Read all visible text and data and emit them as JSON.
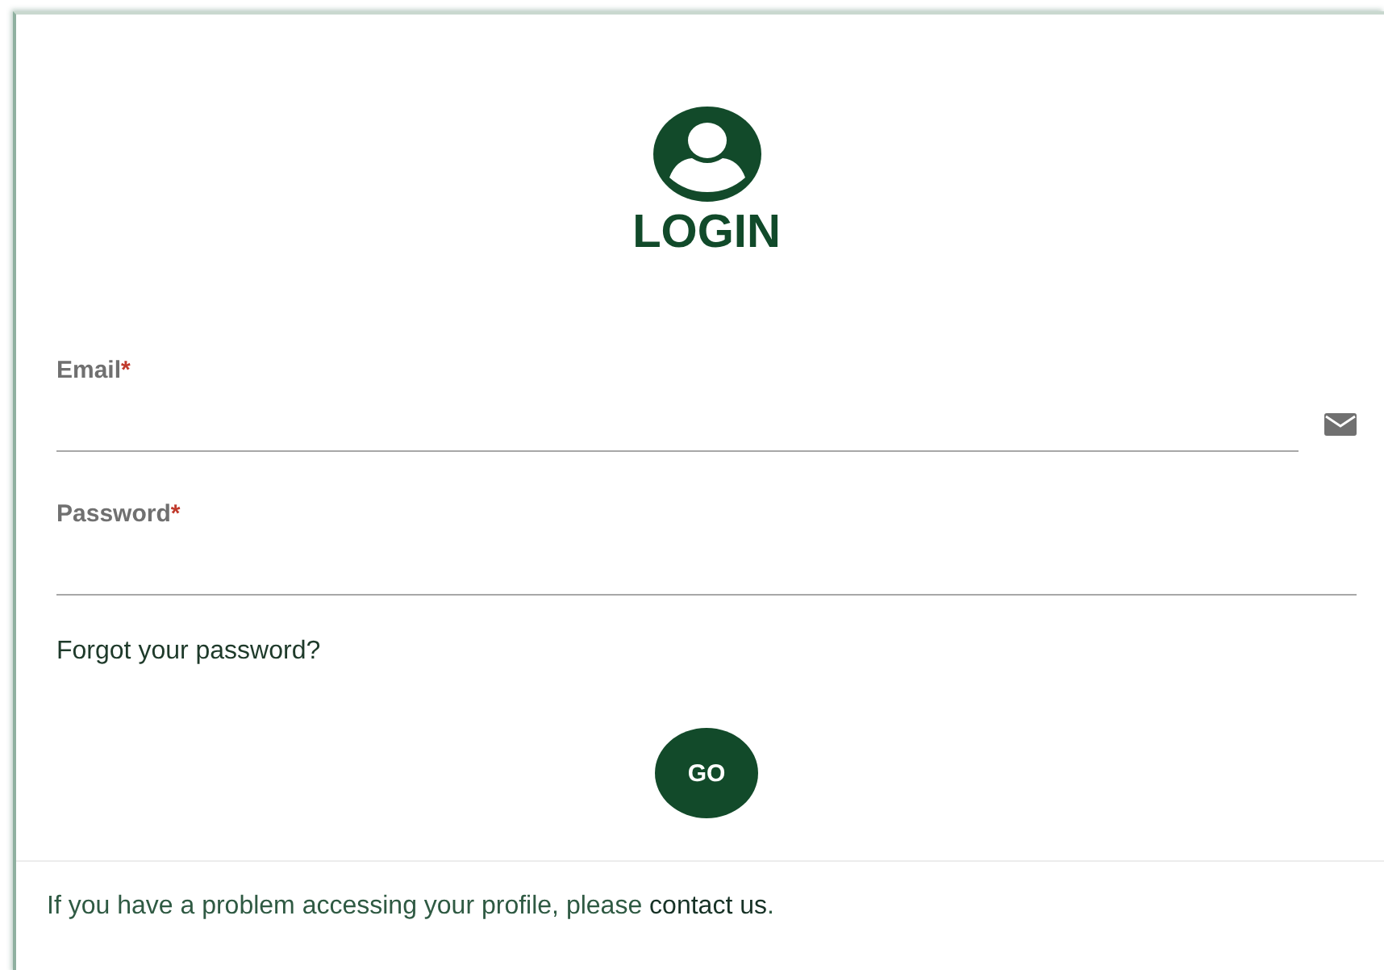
{
  "title": "LOGIN",
  "fields": [
    {
      "label": "Email",
      "required_mark": "*",
      "kind": "email"
    },
    {
      "label": "Password",
      "required_mark": "*",
      "kind": "password"
    }
  ],
  "forgot_link": "Forgot your password?",
  "submit_button": "GO",
  "footer": {
    "text": "If you have a problem accessing your profile, please ",
    "link": "contact us",
    "end": "."
  }
}
